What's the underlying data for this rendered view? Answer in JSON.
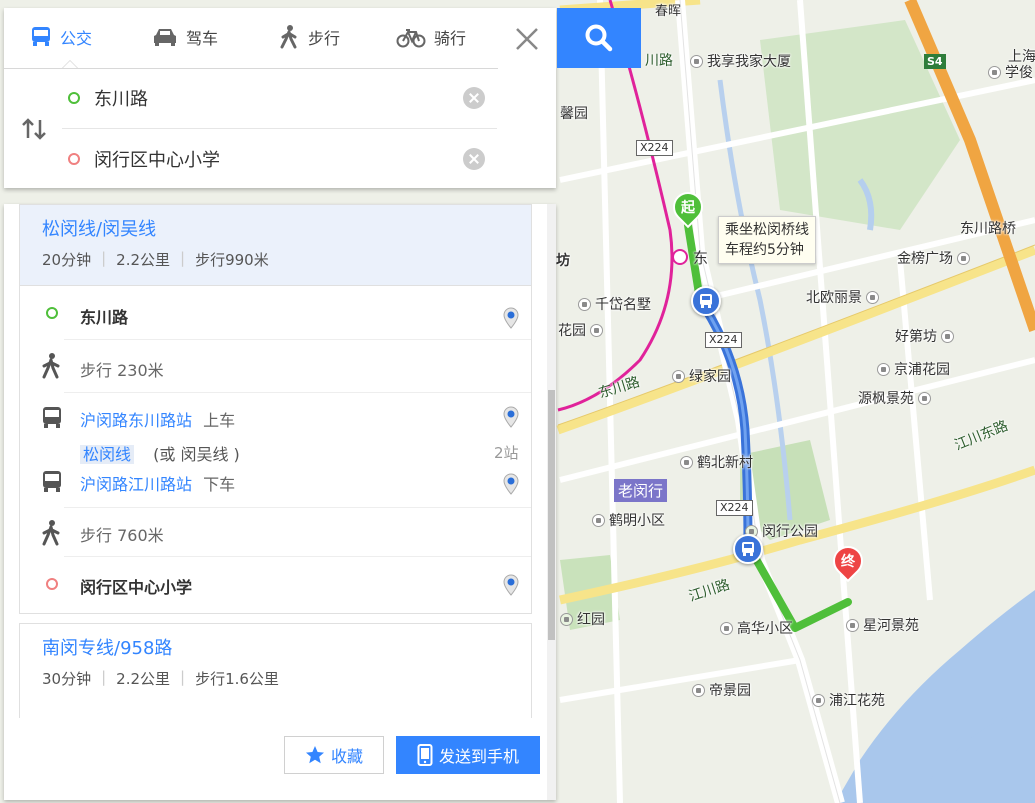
{
  "tabs": [
    {
      "label": "公交",
      "icon": "bus-icon",
      "active": true
    },
    {
      "label": "驾车",
      "icon": "car-icon",
      "active": false
    },
    {
      "label": "步行",
      "icon": "walk-icon",
      "active": false
    },
    {
      "label": "骑行",
      "icon": "bicycle-icon",
      "active": false
    }
  ],
  "search": {
    "origin": "东川路",
    "destination": "闵行区中心小学"
  },
  "routes": [
    {
      "title": "松闵线/闵吴线",
      "duration": "20分钟",
      "distance": "2.2公里",
      "walk": "步行990米",
      "steps": {
        "start": "东川路",
        "walk1": "步行  230米",
        "board_stop": "沪闵路东川路站",
        "board_action": "上车",
        "line": "松闵线",
        "alt_line": "(或 闵吴线 )",
        "stops": "2站",
        "alight_stop": "沪闵路江川路站",
        "alight_action": "下车",
        "walk2": "步行  760米",
        "end": "闵行区中心小学"
      }
    },
    {
      "title": "南闵专线/958路",
      "duration": "30分钟",
      "distance": "2.2公里",
      "walk": "步行1.6公里"
    }
  ],
  "buttons": {
    "favorite": "收藏",
    "send": "发送到手机"
  },
  "map": {
    "bubble_line1": "乘坐松闵桥线",
    "bubble_line2": "车程约5分钟",
    "start_marker": "起",
    "end_marker": "终",
    "district": "老闵行",
    "labels": {
      "l1": "我享我家大厦",
      "l2": "馨园",
      "l3": "千岱名墅",
      "l4": "花园",
      "l5": "绿家园",
      "l6": "鹤北新村",
      "l7": "鹤明小区",
      "l8": "闵行公园",
      "l9": "高华小区",
      "l10": "星河景苑",
      "l11": "帝景园",
      "l12": "浦江花苑",
      "l13": "红园",
      "l14": "金榜广场",
      "l15": "北欧丽景",
      "l16": "好第坊",
      "l17": "京浦花园",
      "l18": "源枫景苑",
      "l19": "上海",
      "l20": "学俊"
    },
    "roads": {
      "r1": "川路",
      "r2": "东川路",
      "r3": "江川东路",
      "r4": "东川路桥",
      "r5": "江川路",
      "r6": "坊",
      "r7": "东",
      "r8": "春晖"
    },
    "shields": {
      "s1": "X224",
      "s2": "X224",
      "s3": "X224",
      "s4": "S4"
    }
  }
}
